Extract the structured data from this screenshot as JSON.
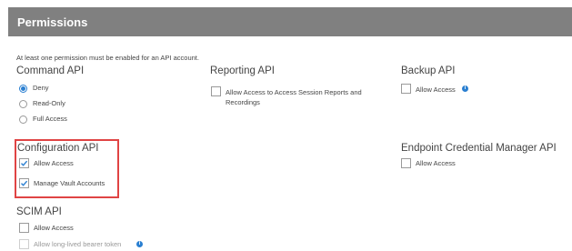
{
  "header": {
    "title": "Permissions"
  },
  "note": "At least one permission must be enabled for an API account.",
  "command_api": {
    "title": "Command API",
    "options": [
      "Deny",
      "Read-Only",
      "Full Access"
    ],
    "selected": "Deny"
  },
  "reporting_api": {
    "title": "Reporting API",
    "allow_label_line1": "Allow Access to Access Session Reports and",
    "allow_label_line2": "Recordings",
    "checked": false
  },
  "backup_api": {
    "title": "Backup API",
    "allow_label": "Allow Access",
    "checked": false,
    "info_icon": "info-icon"
  },
  "configuration_api": {
    "title": "Configuration API",
    "allow_label": "Allow Access",
    "allow_checked": true,
    "vault_label": "Manage Vault Accounts",
    "vault_checked": true,
    "highlight_color": "#e04444"
  },
  "endpoint_api": {
    "title": "Endpoint Credential Manager API",
    "allow_label": "Allow Access",
    "checked": false
  },
  "scim_api": {
    "title": "SCIM API",
    "allow_label": "Allow Access",
    "allow_checked": false,
    "token_label": "Allow long-lived bearer token",
    "token_checked": false,
    "token_disabled": true,
    "info_icon": "info-icon"
  },
  "colors": {
    "header_bg": "#808080",
    "accent": "#2a7fd1",
    "highlight": "#e04444"
  }
}
